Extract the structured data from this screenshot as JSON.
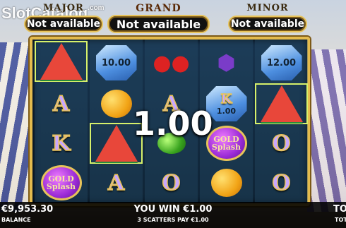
{
  "watermark": {
    "text": "SlotCatalog",
    "suffix": ".com"
  },
  "jackpots": {
    "major": {
      "title": "MAJOR",
      "value": "Not available"
    },
    "grand": {
      "title": "GRAND",
      "value": "Not available"
    },
    "minor": {
      "title": "MINOR",
      "value": "Not available"
    }
  },
  "reels": [
    [
      {
        "sym": "watermelon"
      },
      {
        "sym": "A"
      },
      {
        "sym": "K"
      },
      {
        "sym": "gold-splash",
        "line1": "GOLD",
        "line2": "Splash"
      }
    ],
    [
      {
        "sym": "gem",
        "value": "10.00"
      },
      {
        "sym": "orange"
      },
      {
        "sym": "watermelon"
      },
      {
        "sym": "A"
      }
    ],
    [
      {
        "sym": "cherry"
      },
      {
        "sym": "A"
      },
      {
        "sym": "lime"
      },
      {
        "sym": "O"
      }
    ],
    [
      {
        "sym": "grapes"
      },
      {
        "sym": "gem",
        "value": "1.00",
        "letter": "K"
      },
      {
        "sym": "gold-splash",
        "line1": "GOLD",
        "line2": "Splash"
      },
      {
        "sym": "orange"
      }
    ],
    [
      {
        "sym": "gem",
        "value": "12.00"
      },
      {
        "sym": "watermelon"
      },
      {
        "sym": "O"
      },
      {
        "sym": "O"
      }
    ]
  ],
  "win_overlay": "1.00",
  "bottom": {
    "balance_value": "€9,953.30",
    "balance_label": "BALANCE",
    "win_value": "YOU WIN €1.00",
    "win_line": "3 SCATTERS PAY €1.00",
    "total_value": "TOT",
    "total_label": "TOT"
  },
  "colors": {
    "frame": "#e4bb4d",
    "highlight": "#d6f06a",
    "bar": "#000000"
  }
}
